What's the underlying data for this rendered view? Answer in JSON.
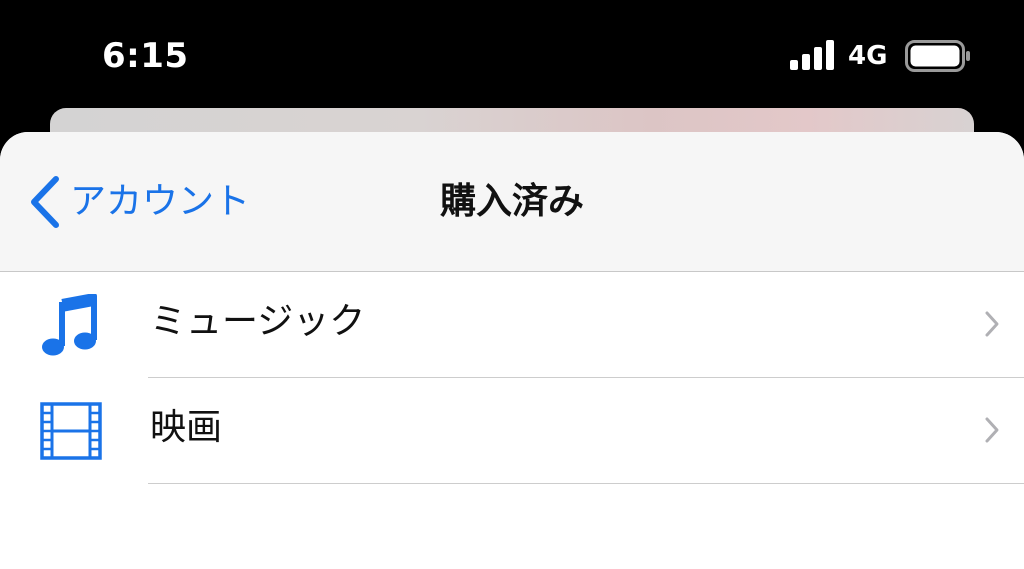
{
  "status_bar": {
    "time": "6:15",
    "network": "4G",
    "signal_icon": "signal-bars-icon",
    "battery_icon": "battery-icon"
  },
  "nav": {
    "back_label": "アカウント",
    "title": "購入済み",
    "back_icon": "chevron-left-icon"
  },
  "list": {
    "items": [
      {
        "label": "ミュージック",
        "icon": "music-note-icon"
      },
      {
        "label": "映画",
        "icon": "film-icon"
      }
    ]
  },
  "colors": {
    "accent": "#1a73e8",
    "nav_background": "#f6f6f6",
    "status_background": "#000000"
  }
}
